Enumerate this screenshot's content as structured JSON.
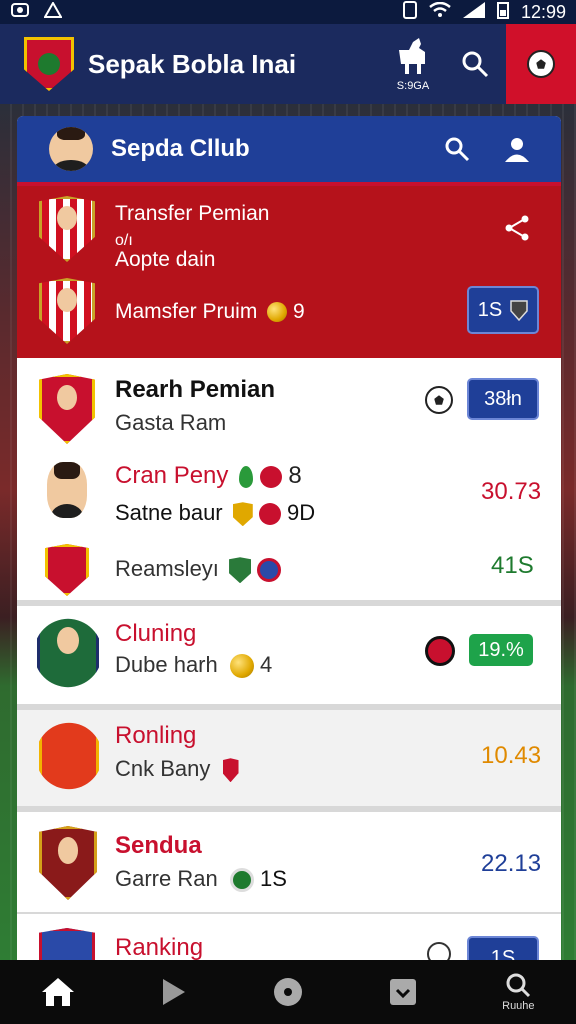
{
  "status_bar": {
    "time": "12:99"
  },
  "app_bar": {
    "title": "Sepak Bobla Inai",
    "mascot_label": "S:9GA"
  },
  "card_header": {
    "title": "Sepda Cllub"
  },
  "transfer": {
    "title": "Transfer Pemian",
    "sub1": "o/ı",
    "sub2": "Aopte dain",
    "name": "Mamsfer Pruim",
    "name_num": "9",
    "badge": "1S"
  },
  "rows": [
    {
      "title": "Rearh Pemian",
      "sub": "Gasta Ram",
      "badge": "38łn"
    },
    {
      "title": "Cran Peny",
      "title_num": "8",
      "value": "30.73"
    },
    {
      "title": "Satne baur",
      "title_num": "9D"
    },
    {
      "title": "Reamsleyı",
      "value": "41S"
    },
    {
      "title": "Cluning",
      "sub": "Dube harh",
      "sub_num": "4",
      "badge": "19.%"
    },
    {
      "title": "Ronling",
      "sub": "Cnk Bany",
      "value": "10.43"
    },
    {
      "title": "Sendua",
      "sub": "Garre Ran",
      "sub_num": "1S",
      "value": "22.13"
    },
    {
      "title": "Ranking",
      "badge": "1S"
    }
  ],
  "bottom_nav": {
    "search_label": "Ruuhe"
  },
  "colors": {
    "navy": "#1b2a5e",
    "header_blue": "#1f3f98",
    "red": "#b5121b",
    "accent_red": "#c8102e",
    "green": "#1ea34a",
    "orange_value": "#e08a00"
  },
  "icons": [
    "soccer-ball-icon",
    "search-icon",
    "person-icon",
    "share-icon",
    "home-icon",
    "play-icon",
    "disc-icon",
    "download-icon"
  ]
}
